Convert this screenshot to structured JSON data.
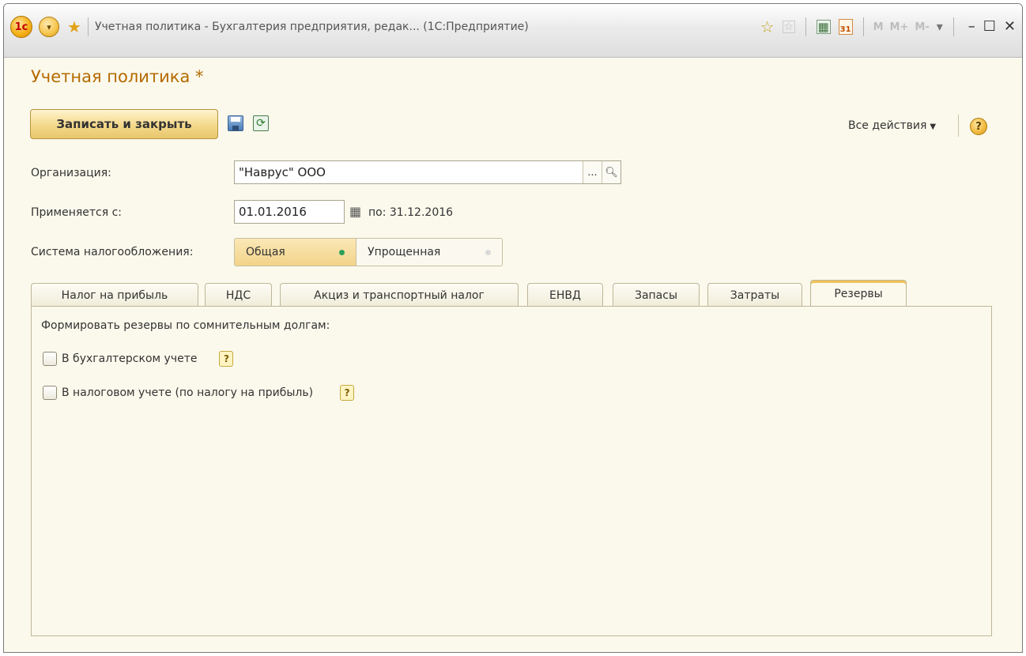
{
  "window": {
    "title": "Учетная политика - Бухгалтерия предприятия, редак... (1С:Предприятие)",
    "logo_text": "1с",
    "calendar_day": "31",
    "mem_buttons": [
      "M",
      "M+",
      "M-"
    ]
  },
  "form": {
    "title": "Учетная политика",
    "modified_mark": "*"
  },
  "toolbar": {
    "save_close_label": "Записать и закрыть",
    "all_actions_label": "Все действия",
    "help_label": "?"
  },
  "fields": {
    "organization_label": "Организация:",
    "organization_value": "\"Наврус\" ООО",
    "organization_select": "...",
    "applies_label": "Применяется с:",
    "applies_value": "01.01.2016",
    "applies_to": "по: 31.12.2016",
    "tax_system_label": "Система налогообложения:",
    "tax_system_options": [
      "Общая",
      "Упрощенная"
    ],
    "tax_system_selected": "Общая"
  },
  "tabs": [
    {
      "label": "Налог на прибыль"
    },
    {
      "label": "НДС"
    },
    {
      "label": "Акциз и транспортный налог"
    },
    {
      "label": "ЕНВД"
    },
    {
      "label": "Запасы"
    },
    {
      "label": "Затраты"
    },
    {
      "label": "Резервы"
    }
  ],
  "active_tab": "Резервы",
  "reserves": {
    "heading": "Формировать резервы по сомнительным долгам:",
    "options": [
      {
        "label": "В бухгалтерском учете",
        "checked": false,
        "hint": "?"
      },
      {
        "label": "В налоговом учете (по налогу на прибыль)",
        "checked": false,
        "hint": "?"
      }
    ]
  },
  "colors": {
    "title_accent": "#b46a00",
    "selected_dot": "#2aa05a",
    "button_fill": "#f4d98a"
  }
}
